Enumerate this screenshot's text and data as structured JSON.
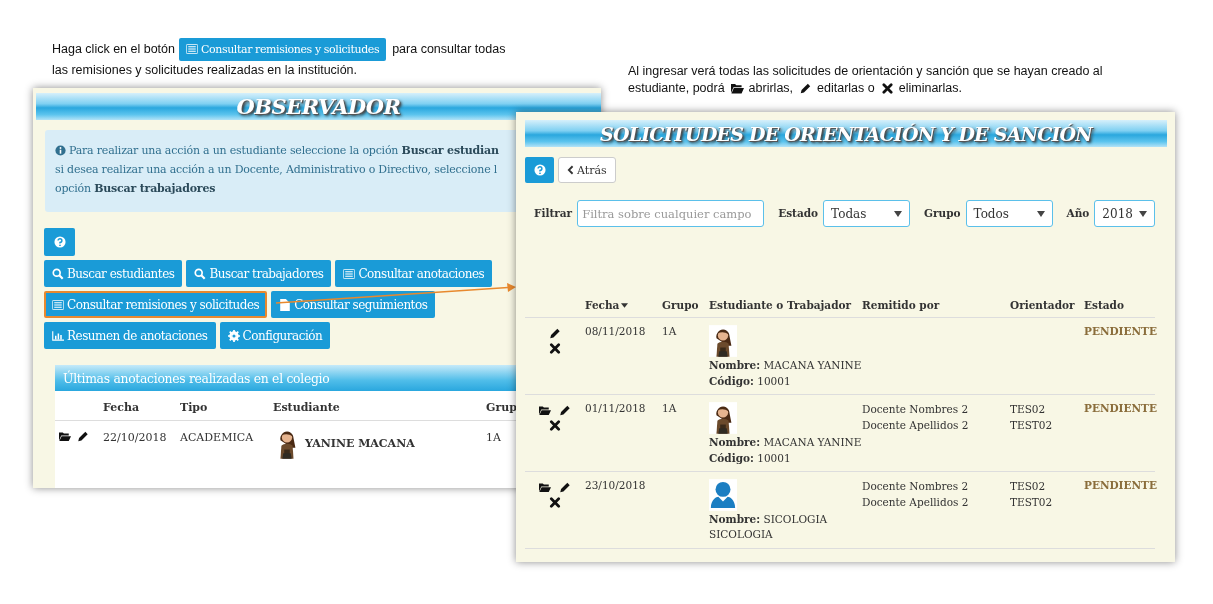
{
  "instruction_1": {
    "before": "Haga click en el botón",
    "button": "Consultar remisiones y solicitudes",
    "after_line_1": "para consultar todas",
    "after_line_2": "las remisiones y solicitudes realizadas en la institución."
  },
  "instruction_2": {
    "line_1": "Al ingresar verá todas las solicitudes de orientación y sanción que se hayan creado al",
    "line_2": [
      "estudiante, podrá",
      "abrirlas,",
      "editarlas o",
      "eliminarlas."
    ]
  },
  "observador_window": {
    "title": "OBSERVADOR",
    "info_lines": [
      "Para realizar una acción a un estudiante seleccione la opción **Buscar estudian**",
      "si desea realizar una acción a un Docente, Administrativo o Directivo, seleccione l",
      "opción **Buscar trabajadores**"
    ],
    "button_rows": [
      [
        {
          "highlighted": false
        }
      ],
      [
        {
          "label": "Buscar estudiantes",
          "highlighted": false
        },
        {
          "label": "Buscar trabajadores",
          "highlighted": false
        },
        {
          "label": "Consultar anotaciones",
          "highlighted": false
        }
      ],
      [
        {
          "label": "Consultar remisiones y solicitudes",
          "highlighted": true
        },
        {
          "label": "Consultar seguimientos",
          "highlighted": false
        }
      ],
      [
        {
          "label": "Resumen de anotaciones",
          "highlighted": false
        },
        {
          "label": "Configuración",
          "highlighted": false
        }
      ]
    ],
    "recent_panel": {
      "title": "Últimas anotaciones realizadas en el colegio",
      "columns": [
        "Fecha",
        "Tipo",
        "Estudiante",
        "Grup"
      ],
      "rows": [
        {
          "fecha": "22/10/2018",
          "tipo": "ACADEMICA",
          "estudiante": "YANINE MACANA",
          "grupo": "1A"
        }
      ]
    }
  },
  "solicitudes_window": {
    "title": "SOLICITUDES DE ORIENTACIÓN Y DE SANCIÓN",
    "back_button": "Atrás",
    "filters": [
      {
        "kind": "text",
        "label": "Filtrar",
        "placeholder": "Filtra sobre cualquier campo"
      },
      {
        "kind": "select",
        "label": "Estado",
        "value": "Todas"
      },
      {
        "kind": "select",
        "label": "Grupo",
        "value": "Todos"
      },
      {
        "kind": "select",
        "label": "Año",
        "value": "2018"
      }
    ],
    "columns": [
      {
        "label": "Fecha",
        "sorted": true
      },
      {
        "label": "Grupo",
        "sorted": false
      },
      {
        "label": "Estudiante o Trabajador",
        "sorted": false
      },
      {
        "label": "Remitido por",
        "sorted": false
      },
      {
        "label": "Orientador",
        "sorted": false
      },
      {
        "label": "Estado",
        "sorted": false
      }
    ],
    "rows": [
      {
        "can_open": false,
        "fecha": "08/11/2018",
        "grupo": "1A",
        "has_photo": true,
        "nombre": "**Nombre:** MACANA YANINE",
        "codigo": "**Código:** 10001",
        "remitido_por": [],
        "orientador": [],
        "estado": "PENDIENTE"
      },
      {
        "can_open": true,
        "fecha": "01/11/2018",
        "grupo": "1A",
        "has_photo": true,
        "nombre": "**Nombre:** MACANA YANINE",
        "codigo": "**Código:** 10001",
        "remitido_por": [
          "Docente Nombres 2",
          "Docente Apellidos 2"
        ],
        "orientador": [
          "TES02",
          "TEST02"
        ],
        "estado": "PENDIENTE"
      },
      {
        "can_open": true,
        "fecha": "23/10/2018",
        "has_photo": false,
        "nombre": "**Nombre:** SICOLOGIA SICOLOGIA",
        "remitido_por": [
          "Docente Nombres 2",
          "Docente Apellidos 2"
        ],
        "orientador": [
          "TES02",
          "TEST02"
        ],
        "estado": "PENDIENTE"
      }
    ]
  }
}
